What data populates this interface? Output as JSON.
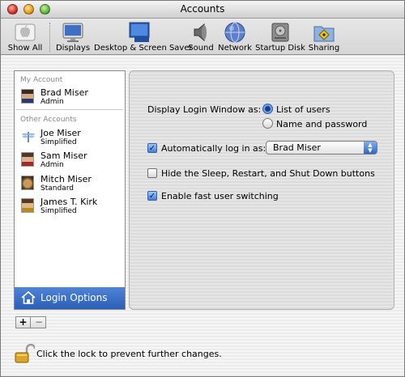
{
  "window": {
    "title": "Accounts"
  },
  "toolbar": {
    "items": [
      {
        "label": "Show All",
        "icon": "apple-icon"
      },
      {
        "label": "Displays",
        "icon": "display-icon"
      },
      {
        "label": "Desktop & Screen Saver",
        "icon": "desktop-icon"
      },
      {
        "label": "Sound",
        "icon": "speaker-icon"
      },
      {
        "label": "Network",
        "icon": "globe-icon"
      },
      {
        "label": "Startup Disk",
        "icon": "disk-icon"
      },
      {
        "label": "Sharing",
        "icon": "sharing-folder-icon"
      }
    ]
  },
  "sidebar": {
    "my_account_header": "My Account",
    "other_accounts_header": "Other Accounts",
    "my_account": {
      "name": "Brad Miser",
      "role": "Admin"
    },
    "accounts": [
      {
        "name": "Joe Miser",
        "role": "Simplified",
        "icon": "dragonfly-icon"
      },
      {
        "name": "Sam Miser",
        "role": "Admin",
        "icon": "user-photo-icon"
      },
      {
        "name": "Mitch Miser",
        "role": "Standard",
        "icon": "cat-icon"
      },
      {
        "name": "James T. Kirk",
        "role": "Simplified",
        "icon": "user-photo-icon"
      }
    ],
    "login_options_label": "Login Options",
    "add_label": "+",
    "remove_label": "−"
  },
  "content": {
    "display_login_label": "Display Login Window as:",
    "option_list": "List of users",
    "option_name_password": "Name and password",
    "selected_display_option": "List of users",
    "auto_login_label": "Automatically log in as:",
    "auto_login_checked": true,
    "auto_login_user": "Brad Miser",
    "hide_buttons_label": "Hide the Sleep, Restart, and Shut Down buttons",
    "hide_buttons_checked": false,
    "fast_switch_label": "Enable fast user switching",
    "fast_switch_checked": true
  },
  "footer": {
    "lock_text": "Click the lock to prevent further changes."
  },
  "colors": {
    "selection_blue": "#2b5fb8",
    "radio_blue": "#3a78d6"
  }
}
